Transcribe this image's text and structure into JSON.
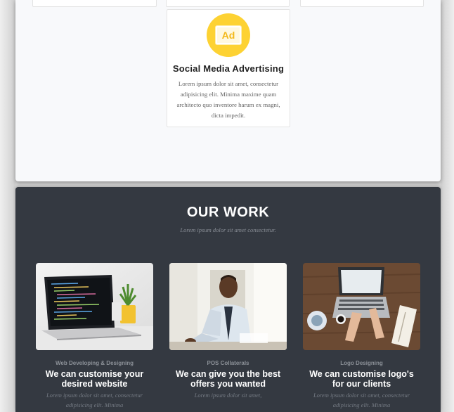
{
  "services": {
    "card": {
      "icon": "ad-icon",
      "icon_text": "Ad",
      "title": "Social Media Advertising",
      "description": "Lorem ipsum dolor sit amet, consectetur adipisicing elit. Minima maxime quam architecto quo inventore harum ex magni, dicta impedit."
    },
    "accent_color": "#fdd233"
  },
  "work": {
    "title": "OUR WORK",
    "subtitle": "Lorem ipsum dolor sit amet consectetur.",
    "background_color": "#343941",
    "items": [
      {
        "image": "laptop-code-image",
        "category": "Web Developing & Designing",
        "heading": "We can customise your desired website",
        "text": "Lorem ipsum dolor sit amet, consectetur adipisicing elit. Minima"
      },
      {
        "image": "businessman-handshake-image",
        "category": "POS Collaterals",
        "heading": "We can give you the best offers you wanted",
        "text": "Lorem ipsum dolor sit amet,"
      },
      {
        "image": "desk-laptop-image",
        "category": "Logo Designing",
        "heading": "We can customise logo's for our clients",
        "text": "Lorem ipsum dolor sit amet, consectetur adipisicing elit. Minima"
      }
    ]
  }
}
